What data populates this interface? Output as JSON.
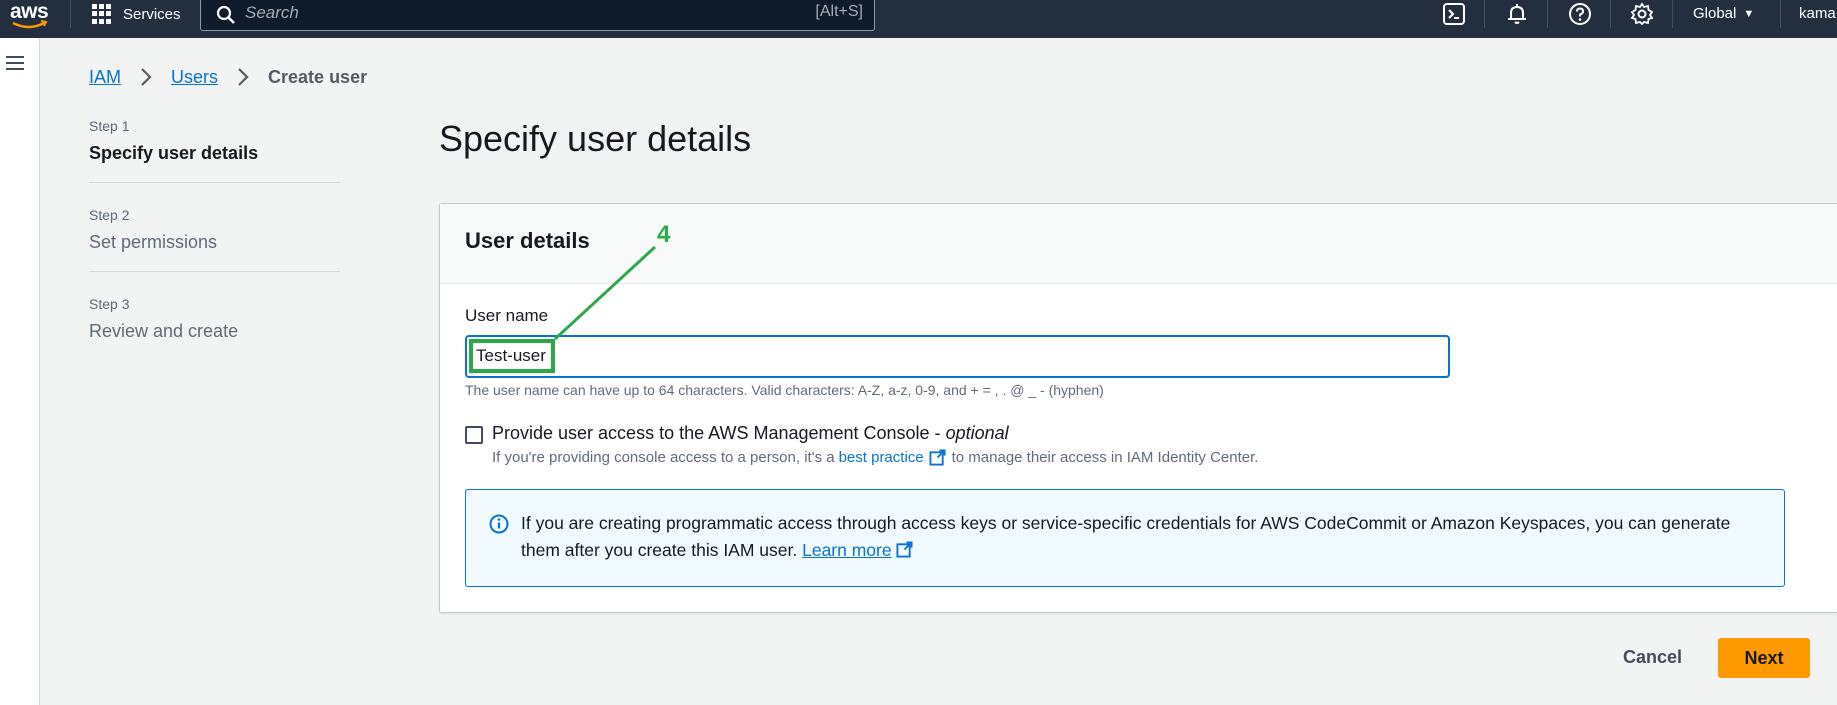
{
  "topnav": {
    "logo_text": "aws",
    "services_label": "Services",
    "search_placeholder": "Search",
    "search_shortcut": "[Alt+S]",
    "region_label": "Global",
    "account_label": "kama",
    "icons": [
      "cloudshell-icon",
      "bell-icon",
      "help-icon",
      "gear-icon"
    ]
  },
  "breadcrumb": {
    "items": [
      "IAM",
      "Users"
    ],
    "current": "Create user"
  },
  "steps": [
    {
      "num": "Step 1",
      "title": "Specify user details",
      "active": true
    },
    {
      "num": "Step 2",
      "title": "Set permissions",
      "active": false
    },
    {
      "num": "Step 3",
      "title": "Review and create",
      "active": false
    }
  ],
  "page_title": "Specify user details",
  "panel": {
    "title": "User details",
    "user_name_label": "User name",
    "user_name_value": "Test-user",
    "user_name_hint": "The user name can have up to 64 characters. Valid characters: A-Z, a-z, 0-9, and + = , . @ _ - (hyphen)",
    "console_access_label": "Provide user access to the AWS Management Console - ",
    "console_access_optional": "optional",
    "console_access_checked": false,
    "console_desc_before": "If you're providing console access to a person, it's a",
    "console_desc_link": "best practice",
    "console_desc_after": "to manage their access in IAM Identity Center.",
    "info_text": "If you are creating programmatic access through access keys or service-specific credentials for AWS CodeCommit or Amazon Keyspaces, you can generate them after you create this IAM user.",
    "info_link": "Learn more"
  },
  "footer": {
    "cancel_label": "Cancel",
    "next_label": "Next"
  },
  "annotation": {
    "label": "4",
    "color": "#2ca84a"
  },
  "colors": {
    "nav_bg": "#232f3e",
    "link": "#0972d3",
    "primary_button": "#ff9900",
    "info_bg": "#f1faff"
  }
}
